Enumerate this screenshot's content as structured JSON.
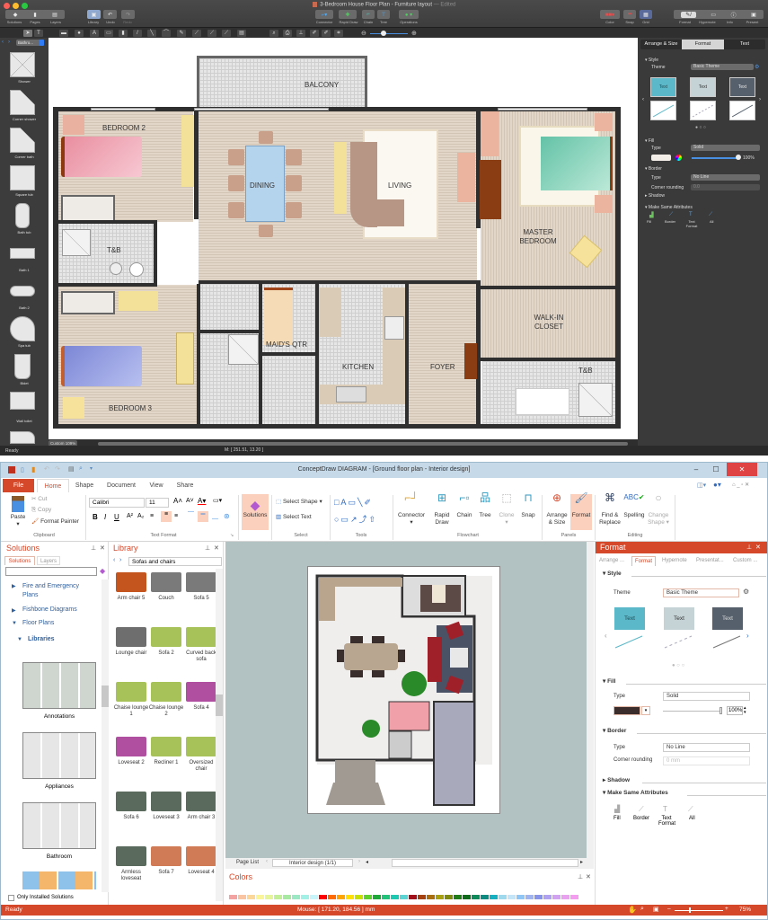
{
  "mac": {
    "title": "3-Bedroom House Floor Plan - Furniture layout",
    "title_suffix": "— Edited",
    "toolbar": {
      "left": [
        {
          "label": "Solutions",
          "icon": "solutions-icon"
        },
        {
          "label": "Pages",
          "icon": "pages-icon"
        },
        {
          "label": "Layers",
          "icon": "layers-icon"
        },
        {
          "label": "Library",
          "icon": "library-icon"
        },
        {
          "label": "Undo",
          "icon": "undo-icon"
        },
        {
          "label": "Redo",
          "icon": "redo-icon"
        }
      ],
      "center": [
        {
          "label": "Connector"
        },
        {
          "label": "Rapid Draw"
        },
        {
          "label": "Chain"
        },
        {
          "label": "Tree"
        },
        {
          "label": "Operations"
        }
      ],
      "right": [
        {
          "label": "Color"
        },
        {
          "label": "Snap"
        },
        {
          "label": "Grid"
        }
      ],
      "panels": [
        {
          "label": "Format"
        },
        {
          "label": "Hypernote"
        },
        {
          "label": "Info"
        },
        {
          "label": "Present"
        }
      ]
    },
    "library_dropdown": "Bathro...",
    "library_shapes": [
      "Shower",
      "Corner shower",
      "Corner bath",
      "Square tub",
      "Bath tub",
      "Bath 1",
      "Bath 2",
      "Spa tub",
      "Bidet",
      "Wall toilet"
    ],
    "zoom_field": "Custom 109%",
    "status": "Ready",
    "mouse": "M: [ 251.51, 13.20 ]",
    "rooms": {
      "balcony": "BALCONY",
      "bedroom2": "BEDROOM 2",
      "dining": "DINING",
      "living": "LIVING",
      "master": "MASTER BEDROOM",
      "tb1": "T&B",
      "maids": "MAID'S QTR",
      "kitchen": "KITCHEN",
      "foyer": "FOYER",
      "walkin": "WALK-IN CLOSET",
      "tb2": "T&B",
      "bedroom3": "BEDROOM 3"
    },
    "panel": {
      "tabs": [
        "Arrange & Size",
        "Format",
        "Text"
      ],
      "active_tab": "Format",
      "style_label": "Style",
      "theme_label": "Theme",
      "theme_value": "Basic Theme",
      "theme_samples": [
        "Text",
        "Text",
        "Text"
      ],
      "fill_label": "Fill",
      "fill_type_label": "Type",
      "fill_type": "Solid",
      "opacity": "100%",
      "border_label": "Border",
      "border_type_label": "Type",
      "border_type": "No Line",
      "corner_label": "Corner rounding",
      "corner_value": "0.0",
      "shadow_label": "Shadow",
      "make_same_label": "Make Same Attributes",
      "make_same": [
        "Fill",
        "Border",
        "Text Format",
        "All"
      ]
    }
  },
  "win": {
    "title": "ConceptDraw DIAGRAM - [Ground floor plan - Interior design]",
    "tabs": [
      "File",
      "Home",
      "Shape",
      "Document",
      "View",
      "Share"
    ],
    "active_tab": "Home",
    "clipboard": {
      "paste": "Paste",
      "cut": "Cut",
      "copy": "Copy",
      "format_painter": "Format Painter",
      "group": "Clipboard"
    },
    "text_format": {
      "font": "Calibri",
      "size": "11",
      "group": "Text Format"
    },
    "solutions_btn": "Solutions",
    "select": {
      "shape": "Select Shape",
      "text": "Select Text",
      "group": "Select"
    },
    "tools_group": "Tools",
    "flowchart": {
      "connector": "Connector",
      "rapid_draw": "Rapid Draw",
      "chain": "Chain",
      "tree": "Tree",
      "clone": "Clone",
      "snap": "Snap",
      "group": "Flowchart"
    },
    "panels": {
      "arrange": "Arrange & Size",
      "format": "Format",
      "group": "Panels"
    },
    "editing": {
      "find": "Find & Replace",
      "spelling": "Spelling",
      "change_shape": "Change Shape",
      "group": "Editing"
    },
    "solutions_panel": {
      "title": "Solutions",
      "tabs": [
        "Solutions",
        "Layers"
      ],
      "items": [
        "Fire and Emergency Plans",
        "Fishbone Diagrams",
        "Floor Plans"
      ],
      "libraries": "Libraries",
      "groups": [
        "Annotations",
        "Appliances",
        "Bathroom"
      ],
      "only_installed": "Only Installed Solutions"
    },
    "library_panel": {
      "title": "Library",
      "dropdown": "Sofas and chairs",
      "items": [
        {
          "label": "Arm chair 5",
          "color": "#c4551f"
        },
        {
          "label": "Couch",
          "color": "#7a7a7a"
        },
        {
          "label": "Sofa 5",
          "color": "#7a7a7a"
        },
        {
          "label": "Lounge chair",
          "color": "#6e6e6e"
        },
        {
          "label": "Sofa 2",
          "color": "#a8c25a"
        },
        {
          "label": "Curved back sofa",
          "color": "#a8c25a"
        },
        {
          "label": "Chaise lounge 1",
          "color": "#a8c25a"
        },
        {
          "label": "Chaise lounge 2",
          "color": "#a8c25a"
        },
        {
          "label": "Sofa 4",
          "color": "#b04ea0"
        },
        {
          "label": "Loveseat 2",
          "color": "#b04ea0"
        },
        {
          "label": "Recliner 1",
          "color": "#a8c25a"
        },
        {
          "label": "Oversized chair",
          "color": "#a8c25a"
        },
        {
          "label": "Sofa 6",
          "color": "#5a6a5c"
        },
        {
          "label": "Loveseat 3",
          "color": "#5a6a5c"
        },
        {
          "label": "Arm chair 3",
          "color": "#5a6a5c"
        },
        {
          "label": "Armless loveseat",
          "color": "#5a6a5c"
        },
        {
          "label": "Sofa 7",
          "color": "#d07b55"
        },
        {
          "label": "Loveseat 4",
          "color": "#d07b55"
        }
      ]
    },
    "page_list": {
      "label": "Page List",
      "page": "Interior design (1/1)"
    },
    "colors_title": "Colors",
    "palette": [
      "#f4a3a3",
      "#f9c4a1",
      "#fbd89a",
      "#fbf59a",
      "#e6f59a",
      "#c3ef99",
      "#a7e8a3",
      "#9de8c4",
      "#a2f0e6",
      "#c7f5f9",
      "#ff0000",
      "#ff6a00",
      "#ffa500",
      "#ffe000",
      "#c8e000",
      "#5fd12c",
      "#1fa83a",
      "#22c27a",
      "#1fc8b0",
      "#5cd4d4",
      "#a00f1a",
      "#a5410f",
      "#a86e10",
      "#a8a010",
      "#7f8a10",
      "#217d17",
      "#0f6a1c",
      "#0f8a5a",
      "#0f8a80",
      "#17b0c0",
      "#9fd9ee",
      "#c4e4f7",
      "#8fc6f5",
      "#a0b4f0",
      "#8794e8",
      "#b0a2f0",
      "#d0a2f0",
      "#e9a2f0",
      "#f49ef0",
      "#f4a1c8"
    ],
    "format_panel": {
      "title": "Format",
      "tabs": [
        "Arrange ...",
        "Format",
        "Hypernote",
        "Presentat...",
        "Custom ..."
      ],
      "active_tab": "Format",
      "style": "Style",
      "theme_label": "Theme",
      "theme_value": "Basic Theme",
      "theme_samples": [
        "Text",
        "Text",
        "Text"
      ],
      "fill": "Fill",
      "fill_type_label": "Type",
      "fill_type": "Solid",
      "fill_color": "#3b2d2b",
      "opacity": "100%",
      "border": "Border",
      "border_type_label": "Type",
      "border_type": "No Line",
      "corner_label": "Corner rounding",
      "corner_value": "0 mm",
      "shadow": "Shadow",
      "make_same": "Make Same Attributes",
      "make_same_items": [
        "Fill",
        "Border",
        "Text Format",
        "All"
      ]
    },
    "status": {
      "ready": "Ready",
      "mouse": "Mouse: [ 171.20, 184.56 ] mm",
      "zoom": "75%"
    }
  },
  "colors": {
    "accent_red": "#d6482a",
    "win_title_bg": "#c5d9e8",
    "mac_dark": "#3a3a3a",
    "theme1": "#5bb8c8",
    "theme2": "#c5d3d6",
    "theme3": "#55606c"
  }
}
